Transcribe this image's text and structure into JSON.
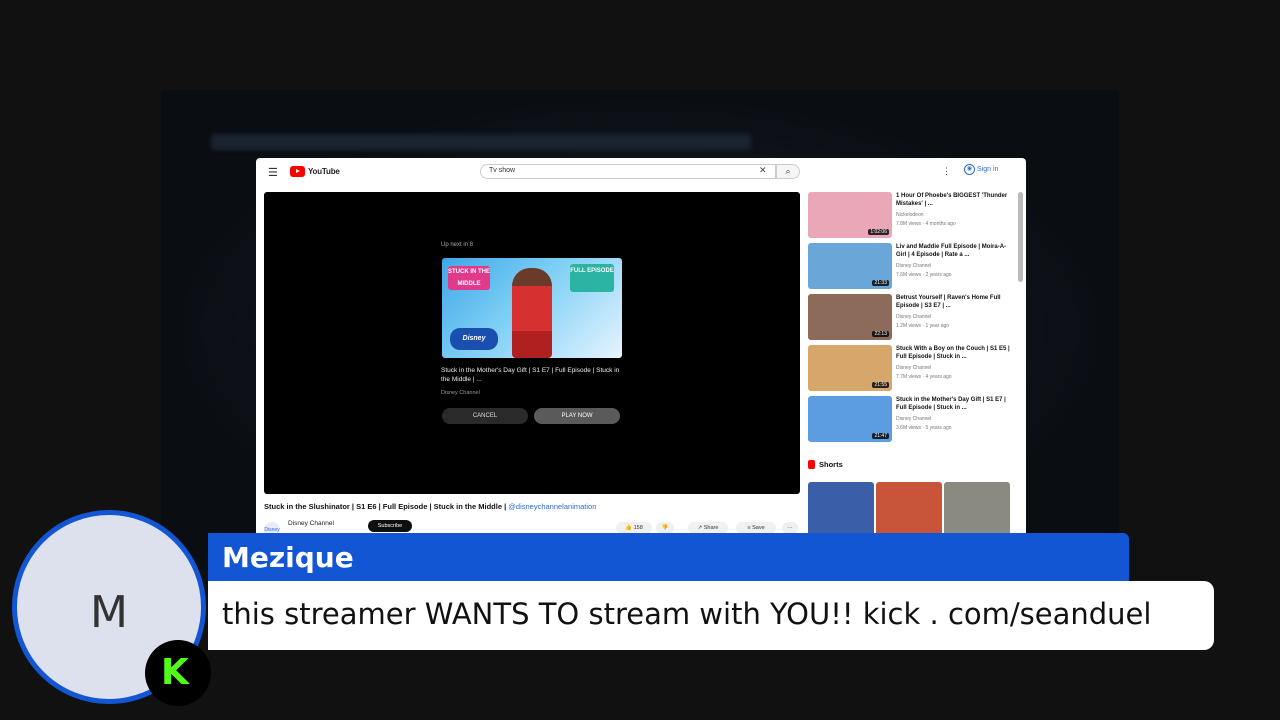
{
  "youtube": {
    "logo_text": "YouTube",
    "search_value": "Tv show",
    "signin_label": "Sign in",
    "upnext": {
      "label": "Up next in 8",
      "title": "Stuck in the Mother's Day Gift | S1 E7 | Full Episode | Stuck in the Middle | ...",
      "channel": "Disney Channel",
      "cancel_label": "CANCEL",
      "play_label": "PLAY NOW",
      "thumb_logo_left": "STUCK IN THE MIDDLE",
      "thumb_logo_right": "FULL EPISODE",
      "thumb_disney": "Disney"
    },
    "video_title": "Stuck in the Slushinator | S1 E6 | Full Episode | Stuck in the Middle |",
    "video_tag": "@disneychannelanimation",
    "channel_name": "Disney Channel",
    "avatar_text": "Disney",
    "subscribe_label": "Subscribe",
    "actions": {
      "like": "158",
      "dislike": "",
      "share": "Share",
      "save": "Save",
      "more": "···"
    },
    "recommendations": [
      {
        "title": "1 Hour Of Phoebe's BIGGEST 'Thunder Mistakes' | ...",
        "channel": "Nickelodeon",
        "meta": "7.8M views · 4 months ago",
        "duration": "1:02:06",
        "color": "#e9a7b8"
      },
      {
        "title": "Liv and Maddie Full Episode | Moira-A-Girl | 4 Episode | Rate a ...",
        "channel": "Disney Channel",
        "meta": "7.6M views · 2 years ago",
        "duration": "21:33",
        "color": "#6aa7d8"
      },
      {
        "title": "Betrust Yourself | Raven's Home Full Episode | S3 E7 | ...",
        "channel": "Disney Channel",
        "meta": "1.2M views · 1 year ago",
        "duration": "22:13",
        "color": "#8c6b5a"
      },
      {
        "title": "Stuck With a Boy on the Couch | S1 E5 | Full Episode | Stuck in ...",
        "channel": "Disney Channel",
        "meta": "7.7M views · 4 years ago",
        "duration": "21:55",
        "color": "#d7a66b"
      },
      {
        "title": "Stuck in the Mother's Day Gift | S1 E7 | Full Episode | Stuck in ...",
        "channel": "Disney Channel",
        "meta": "3.6M views · 5 years ago",
        "duration": "21:47",
        "color": "#5b9de0"
      }
    ],
    "shorts_label": "Shorts",
    "shorts_colors": [
      "#3a5fa8",
      "#c8553a",
      "#8a8a80"
    ]
  },
  "alert": {
    "username": "Mezique",
    "avatar_letter": "M",
    "message": "this streamer WANTS TO stream with YOU!! kick . com/seanduel",
    "kick_letter": "K",
    "colors": {
      "name_bar": "#1356d4",
      "kick_green": "#53fc18"
    }
  }
}
